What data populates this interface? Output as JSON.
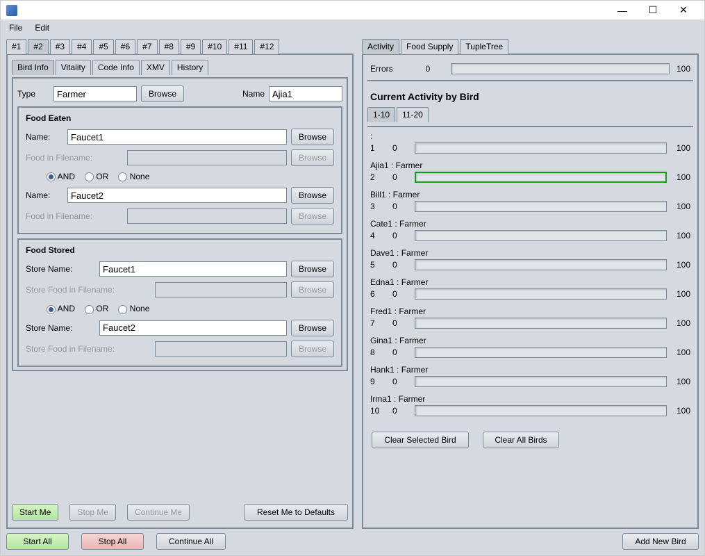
{
  "menus": {
    "file": "File",
    "edit": "Edit"
  },
  "topTabs": [
    "#1",
    "#2",
    "#3",
    "#4",
    "#5",
    "#6",
    "#7",
    "#8",
    "#9",
    "#10",
    "#11",
    "#12"
  ],
  "topTabActive": 1,
  "infoTabs": [
    "Bird Info",
    "Vitality",
    "Code Info",
    "XMV",
    "History"
  ],
  "infoTabActive": 0,
  "labels": {
    "type": "Type",
    "browse": "Browse",
    "name": "Name",
    "nameColon": "Name:",
    "foodEaten": "Food Eaten",
    "foodStored": "Food Stored",
    "foodInFilename": "Food in Filename:",
    "storeName": "Store Name:",
    "storeFoodInFilename": "Store Food in Filename:",
    "and": "AND",
    "or": "OR",
    "none": "None",
    "startMe": "Start Me",
    "stopMe": "Stop Me",
    "continueMe": "Continue Me",
    "resetMe": "Reset Me to Defaults",
    "startAll": "Start All",
    "stopAll": "Stop All",
    "continueAll": "Continue All",
    "addNewBird": "Add New Bird",
    "errors": "Errors",
    "currentActivity": "Current Activity by Bird",
    "clearSelected": "Clear Selected Bird",
    "clearAll": "Clear All Birds",
    "hundred": "100",
    "zero": "0"
  },
  "form": {
    "type": "Farmer",
    "name": "Ajia1",
    "eatenName1": "Faucet1",
    "eatenName2": "Faucet2",
    "storeName1": "Faucet1",
    "storeName2": "Faucet2"
  },
  "rightTabs": [
    "Activity",
    "Food Supply",
    "TupleTree"
  ],
  "rightTabActive": 0,
  "rangeTabs": [
    "1-10",
    "11-20"
  ],
  "rangeTabActive": 0,
  "errorsValue": "0",
  "birds": [
    {
      "idx": "1",
      "label": ":",
      "val": "0",
      "hl": false
    },
    {
      "idx": "2",
      "label": "Ajia1 : Farmer",
      "val": "0",
      "hl": true
    },
    {
      "idx": "3",
      "label": "Bill1 : Farmer",
      "val": "0",
      "hl": false
    },
    {
      "idx": "4",
      "label": "Cate1 : Farmer",
      "val": "0",
      "hl": false
    },
    {
      "idx": "5",
      "label": "Dave1 : Farmer",
      "val": "0",
      "hl": false
    },
    {
      "idx": "6",
      "label": "Edna1 : Farmer",
      "val": "0",
      "hl": false
    },
    {
      "idx": "7",
      "label": "Fred1 : Farmer",
      "val": "0",
      "hl": false
    },
    {
      "idx": "8",
      "label": "Gina1 : Farmer",
      "val": "0",
      "hl": false
    },
    {
      "idx": "9",
      "label": "Hank1 : Farmer",
      "val": "0",
      "hl": false
    },
    {
      "idx": "10",
      "label": "Irma1 : Farmer",
      "val": "0",
      "hl": false
    }
  ]
}
